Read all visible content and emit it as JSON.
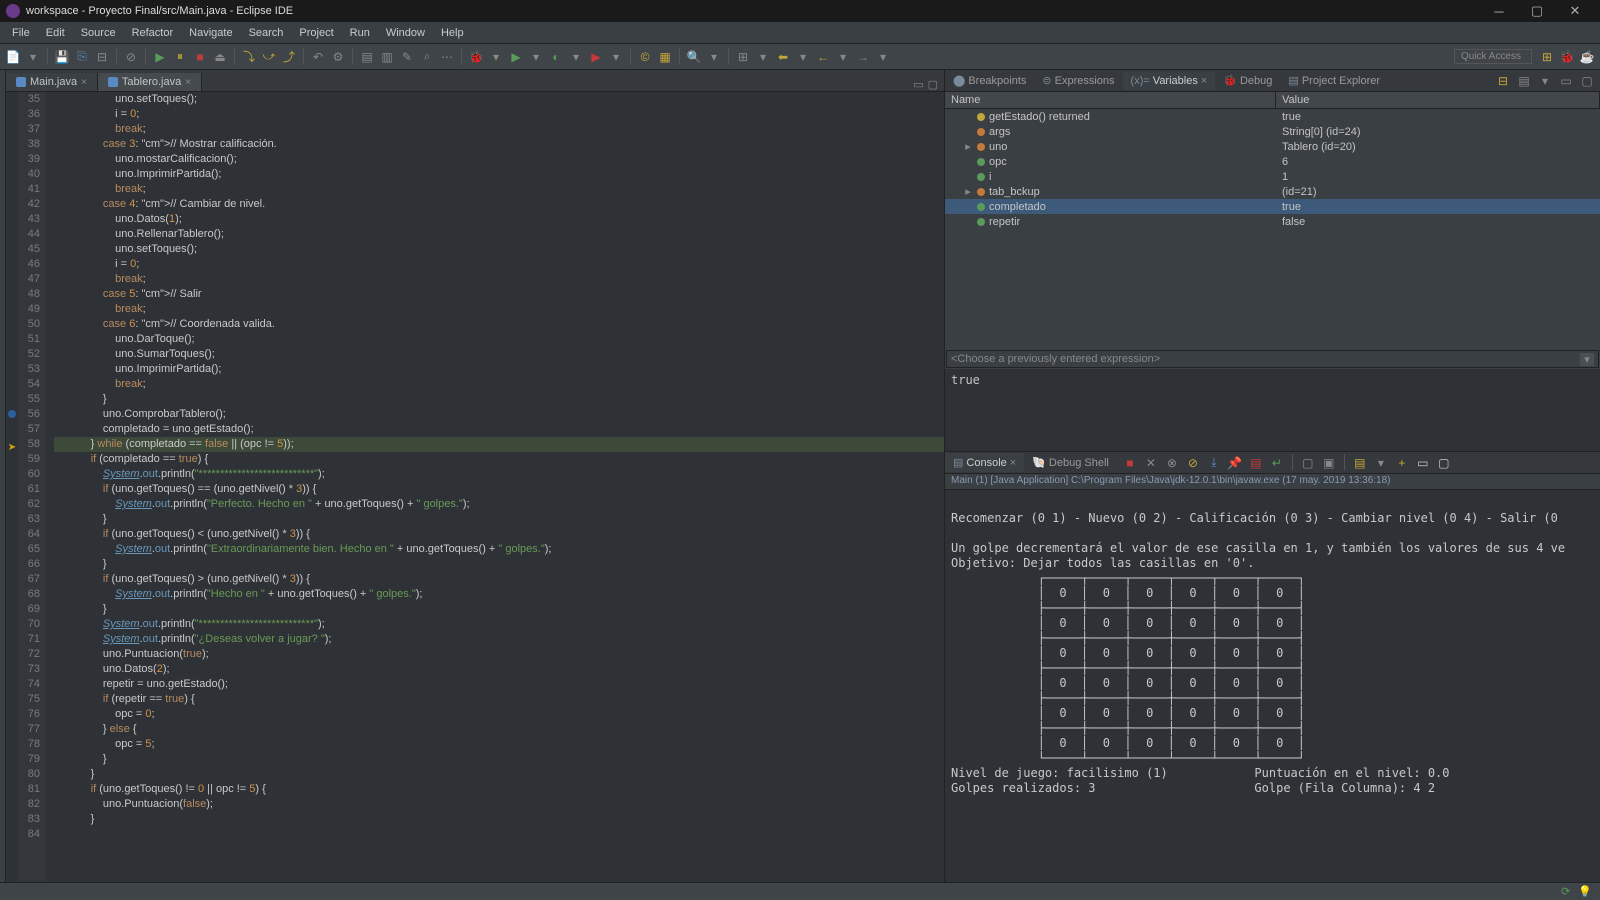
{
  "title": "workspace - Proyecto Final/src/Main.java - Eclipse IDE",
  "menu": [
    "File",
    "Edit",
    "Source",
    "Refactor",
    "Navigate",
    "Search",
    "Project",
    "Run",
    "Window",
    "Help"
  ],
  "quick_access": "Quick Access",
  "editor_tabs": [
    {
      "label": "Main.java",
      "active": true
    },
    {
      "label": "Tablero.java",
      "active": false
    }
  ],
  "code_start_line": 35,
  "code_lines": [
    "                    uno.setToques();",
    "                    i = 0;",
    "                    break;",
    "                case 3: // Mostrar calificación.",
    "                    uno.mostarCalificacion();",
    "                    uno.ImprimirPartida();",
    "                    break;",
    "                case 4: // Cambiar de nivel.",
    "                    uno.Datos(1);",
    "                    uno.RellenarTablero();",
    "                    uno.setToques();",
    "                    i = 0;",
    "                    break;",
    "                case 5: // Salir",
    "                    break;",
    "                case 6: // Coordenada valida.",
    "                    uno.DarToque();",
    "                    uno.SumarToques();",
    "                    uno.ImprimirPartida();",
    "                    break;",
    "                }",
    "                uno.ComprobarTablero();",
    "                completado = uno.getEstado();",
    "            } while (completado == false || (opc != 5));",
    "            if (completado == true) {",
    "                System.out.println(\"***************************\");",
    "                if (uno.getToques() == (uno.getNivel() * 3)) {",
    "                    System.out.println(\"Perfecto. Hecho en \" + uno.getToques() + \" golpes.\");",
    "                }",
    "                if (uno.getToques() < (uno.getNivel() * 3)) {",
    "                    System.out.println(\"Extraordinariamente bien. Hecho en \" + uno.getToques() + \" golpes.\");",
    "                }",
    "                if (uno.getToques() > (uno.getNivel() * 3)) {",
    "                    System.out.println(\"Hecho en \" + uno.getToques() + \" golpes.\");",
    "                }",
    "                System.out.println(\"***************************\");",
    "                System.out.println(\"¿Deseas volver a jugar? \");",
    "                uno.Puntuacion(true);",
    "                uno.Datos(2);",
    "                repetir = uno.getEstado();",
    "                if (repetir == true) {",
    "                    opc = 0;",
    "                } else {",
    "                    opc = 5;",
    "                }",
    "            }",
    "            if (uno.getToques() != 0 || opc != 5) {",
    "                uno.Puntuacion(false);",
    "            }",
    ""
  ],
  "highlight_line": 58,
  "breakpoint_line": 56,
  "view_tabs": [
    {
      "label": "Breakpoints"
    },
    {
      "label": "Expressions"
    },
    {
      "label": "Variables",
      "active": true
    },
    {
      "label": "Debug"
    },
    {
      "label": "Project Explorer"
    }
  ],
  "var_columns": {
    "name": "Name",
    "value": "Value"
  },
  "variables": [
    {
      "name": "getEstado() returned",
      "value": "true",
      "kind": "ret"
    },
    {
      "name": "args",
      "value": "String[0]  (id=24)",
      "kind": "o"
    },
    {
      "name": "uno",
      "value": "Tablero  (id=20)",
      "kind": "o",
      "expandable": true
    },
    {
      "name": "opc",
      "value": "6",
      "kind": "p"
    },
    {
      "name": "i",
      "value": "1",
      "kind": "p"
    },
    {
      "name": "tab_bckup",
      "value": "(id=21)",
      "kind": "o",
      "expandable": true
    },
    {
      "name": "completado",
      "value": "true",
      "kind": "p",
      "selected": true
    },
    {
      "name": "repetir",
      "value": "false",
      "kind": "p"
    }
  ],
  "expr_placeholder": "<Choose a previously entered expression>",
  "expr_result": "true",
  "console_tabs": [
    {
      "label": "Console",
      "active": true
    },
    {
      "label": "Debug Shell"
    }
  ],
  "console_status": "Main (1) [Java Application] C:\\Program Files\\Java\\jdk-12.0.1\\bin\\javaw.exe (17 may. 2019 13:36:18)",
  "console_output": "\nRecomenzar (0 1) - Nuevo (0 2) - Calificación (0 3) - Cambiar nivel (0 4) - Salir (0\n\nUn golpe decrementará el valor de ese casilla en 1, y también los valores de sus 4 ve\nObjetivo: Dejar todos las casillas en '0'.\n            ┌─────┬─────┬─────┬─────┬─────┬─────┐\n            │  0  │  0  │  0  │  0  │  0  │  0  │\n            ├─────┼─────┼─────┼─────┼─────┼─────┤\n            │  0  │  0  │  0  │  0  │  0  │  0  │\n            ├─────┼─────┼─────┼─────┼─────┼─────┤\n            │  0  │  0  │  0  │  0  │  0  │  0  │\n            ├─────┼─────┼─────┼─────┼─────┼─────┤\n            │  0  │  0  │  0  │  0  │  0  │  0  │\n            ├─────┼─────┼─────┼─────┼─────┼─────┤\n            │  0  │  0  │  0  │  0  │  0  │  0  │\n            ├─────┼─────┼─────┼─────┼─────┼─────┤\n            │  0  │  0  │  0  │  0  │  0  │  0  │\n            └─────┴─────┴─────┴─────┴─────┴─────┘\nNivel de juego: facilisimo (1)            Puntuación en el nivel: 0.0\nGolpes realizados: 3                      Golpe (Fila Columna): 4 2\n"
}
